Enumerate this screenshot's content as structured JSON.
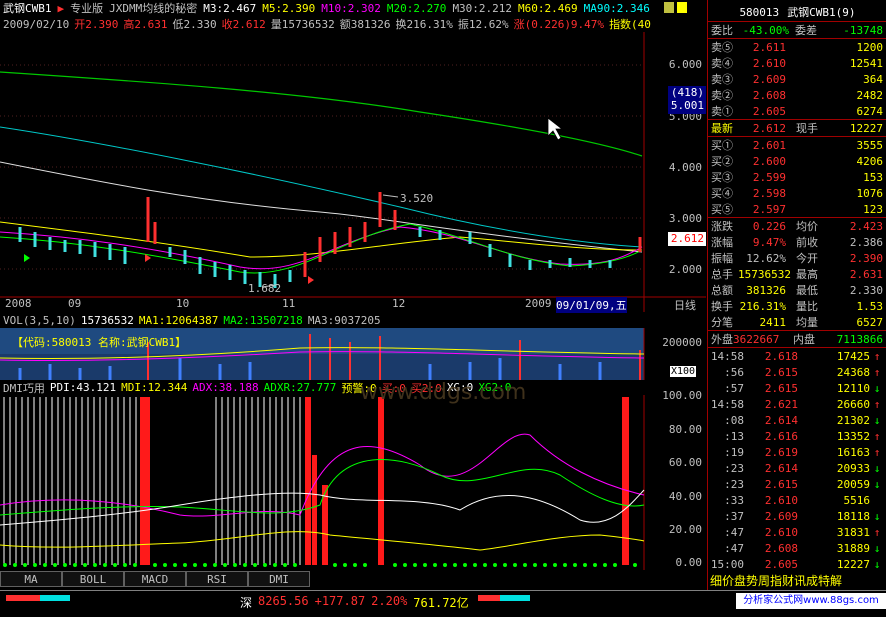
{
  "header": {
    "stock": "武钢CWB1",
    "edition": "专业版",
    "indicator_title": "JXDMM均线的秘密",
    "ma3": "M3:2.467",
    "ma5": "M5:2.390",
    "ma10": "M10:2.302",
    "ma20": "M20:2.270",
    "ma30": "M30:2.212",
    "ma60": "M60:2.469",
    "ma90": "MA90:2.346",
    "date": "2009/02/10",
    "open": "开2.390",
    "high": "高2.631",
    "low": "低2.330",
    "close": "收2.612",
    "volume": "量15736532",
    "amount": "额381326",
    "turnover": "换216.31%",
    "amplitude": "振12.62%",
    "change": "涨(0.226)9.47%",
    "index_label": "指数(40"
  },
  "price_axis": [
    "6.000",
    "5.000",
    "4.000",
    "3.000",
    "2.000"
  ],
  "price_flag": "(418)",
  "price_flag2": "5.001",
  "current_price_tag": "2.612",
  "annotations": {
    "peak": "3.520",
    "low": "1.682"
  },
  "x_axis": {
    "labels": [
      "2008",
      "09",
      "10",
      "11",
      "12",
      "2009",
      "09/01/09,五",
      "日线"
    ]
  },
  "volume_panel": {
    "header_label": "VOL(3,5,10)",
    "vol": "15736532",
    "ma1": "MA1:12064387",
    "ma2": "MA2:13507218",
    "ma3": "MA3:9037205",
    "code_label": "【代码:580013  名称:武钢CWB1】",
    "axis_top": "200000",
    "axis_mid": "100000",
    "unit": "X100"
  },
  "dmi_panel": {
    "title": "DMI巧用",
    "pdi": "PDI:43.121",
    "mdi": "MDI:12.344",
    "adx": "ADX:38.188",
    "adxr": "ADXR:27.777",
    "warn": "预警:0",
    "buy": "买:0",
    "buy2": "买2:0",
    "xg": "XG:0",
    "xg2": "XG2:0",
    "watermark": "www.ddgs.com",
    "axis": [
      "100.00",
      "80.00",
      "60.00",
      "40.00",
      "20.00",
      "0.00"
    ]
  },
  "tabs": [
    "MA",
    "BOLL",
    "MACD",
    "RSI",
    "DMI"
  ],
  "quote": {
    "code": "580013",
    "name": "武钢CWB1(9)",
    "weibi_label": "委比",
    "weibi": "-43.00%",
    "weicha_label": "委差",
    "weicha": "-13748",
    "sells": [
      {
        "label": "卖⑤",
        "price": "2.611",
        "vol": "1200"
      },
      {
        "label": "卖④",
        "price": "2.610",
        "vol": "12541"
      },
      {
        "label": "卖③",
        "price": "2.609",
        "vol": "364"
      },
      {
        "label": "卖②",
        "price": "2.608",
        "vol": "2482"
      },
      {
        "label": "卖①",
        "price": "2.605",
        "vol": "6274"
      }
    ],
    "latest_label": "最新",
    "latest": "2.612",
    "now_hand_label": "现手",
    "now_hand": "12227",
    "buys": [
      {
        "label": "买①",
        "price": "2.601",
        "vol": "3555"
      },
      {
        "label": "买②",
        "price": "2.600",
        "vol": "4206"
      },
      {
        "label": "买③",
        "price": "2.599",
        "vol": "153"
      },
      {
        "label": "买④",
        "price": "2.598",
        "vol": "1076"
      },
      {
        "label": "买⑤",
        "price": "2.597",
        "vol": "123"
      }
    ],
    "stats": [
      {
        "l1": "涨跌",
        "v1": "0.226",
        "l2": "均价",
        "v2": "2.423"
      },
      {
        "l1": "涨幅",
        "v1": "9.47%",
        "l2": "前收",
        "v2": "2.386"
      },
      {
        "l1": "振幅",
        "v1": "12.62%",
        "l2": "今开",
        "v2": "2.390"
      },
      {
        "l1": "总手",
        "v1": "15736532",
        "l2": "最高",
        "v2": "2.631"
      },
      {
        "l1": "总额",
        "v1": "381326",
        "l2": "最低",
        "v2": "2.330"
      },
      {
        "l1": "换手",
        "v1": "216.31%",
        "l2": "量比",
        "v2": "1.53"
      },
      {
        "l1": "分笔",
        "v1": "2411",
        "l2": "均量",
        "v2": "6527"
      }
    ],
    "outer_label": "外盘",
    "outer": "3622667",
    "inner_label": "内盘",
    "inner": "7113866",
    "ticks": [
      {
        "t": "14:58",
        "p": "2.618",
        "v": "17425",
        "d": "↑"
      },
      {
        "t": ":56",
        "p": "2.615",
        "v": "24368",
        "d": "↑"
      },
      {
        "t": ":57",
        "p": "2.615",
        "v": "12110",
        "d": "↓"
      },
      {
        "t": "14:58",
        "p": "2.621",
        "v": "26660",
        "d": "↑"
      },
      {
        "t": ":08",
        "p": "2.614",
        "v": "21302",
        "d": "↓"
      },
      {
        "t": ":13",
        "p": "2.616",
        "v": "13352",
        "d": "↑"
      },
      {
        "t": ":19",
        "p": "2.619",
        "v": "16163",
        "d": "↑"
      },
      {
        "t": ":23",
        "p": "2.614",
        "v": "20933",
        "d": "↓"
      },
      {
        "t": ":23",
        "p": "2.615",
        "v": "20059",
        "d": "↓"
      },
      {
        "t": ":33",
        "p": "2.610",
        "v": "5516",
        "d": ""
      },
      {
        "t": ":37",
        "p": "2.609",
        "v": "18118",
        "d": "↓"
      },
      {
        "t": ":47",
        "p": "2.610",
        "v": "31831",
        "d": "↑"
      },
      {
        "t": ":47",
        "p": "2.608",
        "v": "31889",
        "d": "↓"
      },
      {
        "t": "15:00",
        "p": "2.605",
        "v": "12227",
        "d": "↓"
      }
    ],
    "bottom_tabs": "细价盘势周指财讯成特解"
  },
  "status_bar": {
    "market": "深",
    "index": "8265.56",
    "change": "+177.87",
    "pct": "2.20%",
    "amount": "761.72亿",
    "ad": "分析家公式网www.88gs.com"
  }
}
